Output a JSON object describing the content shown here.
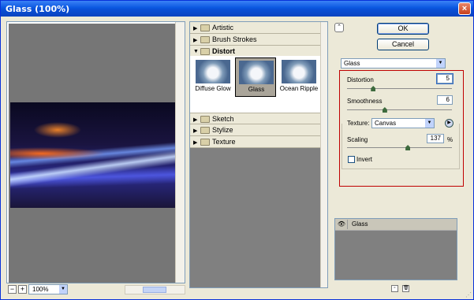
{
  "window": {
    "title": "Glass (100%)",
    "close_glyph": "×"
  },
  "preview": {
    "zoom": "100%",
    "zoom_minus": "−",
    "zoom_plus": "+"
  },
  "gallery": {
    "categories": [
      {
        "label": "Artistic",
        "expanded": false
      },
      {
        "label": "Brush Strokes",
        "expanded": false
      },
      {
        "label": "Distort",
        "expanded": true
      },
      {
        "label": "Sketch",
        "expanded": false
      },
      {
        "label": "Stylize",
        "expanded": false
      },
      {
        "label": "Texture",
        "expanded": false
      }
    ],
    "thumbnails": [
      {
        "label": "Diffuse Glow",
        "selected": false
      },
      {
        "label": "Glass",
        "selected": true
      },
      {
        "label": "Ocean Ripple",
        "selected": false
      }
    ]
  },
  "buttons": {
    "ok": "OK",
    "cancel": "Cancel",
    "collapse_glyph": "⌃"
  },
  "filter": {
    "selected": "Glass"
  },
  "options": {
    "distortion": {
      "label": "Distortion",
      "value": "5",
      "fraction": 0.25
    },
    "smoothness": {
      "label": "Smoothness",
      "value": "6",
      "fraction": 0.36
    },
    "texture": {
      "label": "Texture:",
      "value": "Canvas"
    },
    "scaling": {
      "label": "Scaling",
      "value": "137",
      "unit": "%",
      "fraction": 0.58
    },
    "invert": {
      "label": "Invert",
      "checked": false
    }
  },
  "layers": {
    "items": [
      {
        "name": "Glass",
        "visible": true
      }
    ]
  },
  "icons": {
    "expand": "▶",
    "collapse": "▼",
    "dropdown": "▼",
    "eye": "👁",
    "new_layer": "▫",
    "delete_layer": "🗑",
    "grip": "⋰"
  },
  "colors": {
    "title_bar": "#0a57e0",
    "highlight_box": "#c00000",
    "dialog_bg": "#ece9d8"
  }
}
